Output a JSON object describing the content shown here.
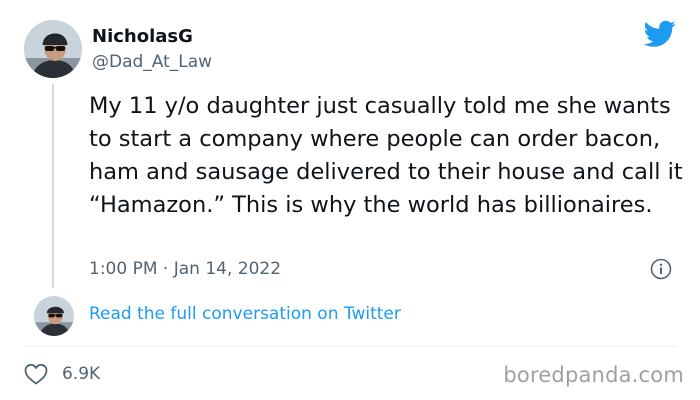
{
  "author": {
    "display_name": "NicholasG",
    "handle": "@Dad_At_Law"
  },
  "tweet": {
    "text": "My 11 y/o daughter just casually told me she wants to start a company where people can order bacon, ham and sausage delivered to their house and call it “Hamazon.” This is why the world has billionaires.",
    "timestamp": "1:00 PM · Jan 14, 2022"
  },
  "reply": {
    "link_text": "Read the full conversation on Twitter"
  },
  "footer": {
    "like_count": "6.9K",
    "watermark": "boredpanda.com"
  },
  "icons": {
    "brand": "twitter-bird-icon",
    "info": "info-icon",
    "like": "heart-icon"
  },
  "colors": {
    "brand_blue": "#1d9bf0",
    "text_primary": "#0f1419",
    "text_secondary": "#536471",
    "divider": "#eff3f4"
  }
}
